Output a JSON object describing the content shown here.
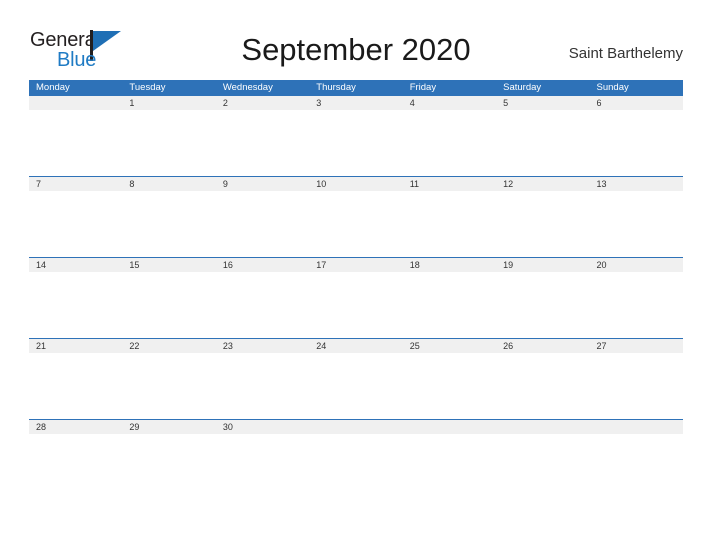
{
  "brand": {
    "name_part1": "General",
    "name_part2": "Blue",
    "mark": "flag-triangle"
  },
  "header": {
    "title": "September 2020",
    "location": "Saint Barthelemy"
  },
  "colors": {
    "header_blue": "#2e72b8",
    "row_band_gray": "#f0f0f0",
    "brand_blue": "#1f7bc4",
    "text_dark": "#333333",
    "page_background": "#ffffff"
  },
  "calendar": {
    "month": "September",
    "year": "2020",
    "week_start": "Monday",
    "weekdays": [
      "Monday",
      "Tuesday",
      "Wednesday",
      "Thursday",
      "Friday",
      "Saturday",
      "Sunday"
    ],
    "weeks": [
      [
        "",
        "1",
        "2",
        "3",
        "4",
        "5",
        "6"
      ],
      [
        "7",
        "8",
        "9",
        "10",
        "11",
        "12",
        "13"
      ],
      [
        "14",
        "15",
        "16",
        "17",
        "18",
        "19",
        "20"
      ],
      [
        "21",
        "22",
        "23",
        "24",
        "25",
        "26",
        "27"
      ],
      [
        "28",
        "29",
        "30",
        "",
        "",
        "",
        ""
      ]
    ]
  }
}
